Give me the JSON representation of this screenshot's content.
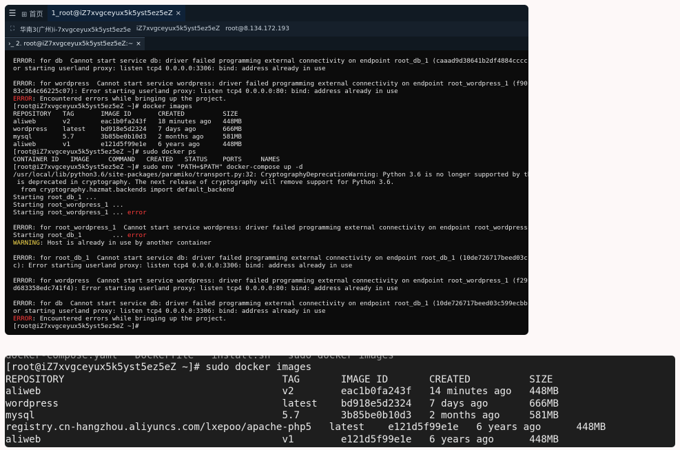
{
  "window1": {
    "tabbar": {
      "menu_icon": "menu-icon",
      "home_label": "⊞ 首页",
      "active_tab": "1_root@iZ7xvgceyux5k5yst5ez5eZ",
      "close_glyph": "×"
    },
    "crumbs": {
      "grid_icon": "grid-icon",
      "segments": [
        "华南3(广州)i-7xvgceyux5k5yst5ez5e",
        "iZ7xvgceyux5k5yst5ez5eZ",
        "root@8.134.172.193"
      ]
    },
    "subtab": {
      "label": "›_ 2. root@iZ7xvgceyux5k5yst5ez5eZ:~",
      "close_glyph": "×"
    },
    "terminal_lines": [
      [
        {
          "t": "ERROR: for db  Cannot start service db: driver failed programming external connectivity on endpoint root_db_1 (caaad9d38641b2df4884cccc"
        }
      ],
      [
        {
          "t": "or starting userland proxy: listen tcp4 0.0.0.0:3306: bind: address already in use"
        }
      ],
      [
        {
          "t": ""
        }
      ],
      [
        {
          "t": "ERROR: for wordpress  Cannot start service wordpress: driver failed programming external connectivity on endpoint root_wordpress_1 (f90"
        }
      ],
      [
        {
          "t": "83c364c66225c07): Error starting userland proxy: listen tcp4 0.0.0.0:80: bind: address already in use"
        }
      ],
      [
        {
          "t": "ERROR",
          "c": "err"
        },
        {
          "t": ": Encountered errors while bringing up the project."
        }
      ],
      [
        {
          "t": "[root@iZ7xvgceyux5k5yst5ez5eZ ~]# docker images"
        }
      ],
      [
        {
          "t": "REPOSITORY   TAG       IMAGE ID       CREATED          SIZE"
        }
      ],
      [
        {
          "t": "aliweb       v2        eac1b0fa243f   18 minutes ago   448MB"
        }
      ],
      [
        {
          "t": "wordpress    latest    bd918e5d2324   7 days ago       666MB"
        }
      ],
      [
        {
          "t": "mysql        5.7       3b85be0b10d3   2 months ago     581MB"
        }
      ],
      [
        {
          "t": "aliweb       v1        e121d5f99e1e   6 years ago      448MB"
        }
      ],
      [
        {
          "t": "[root@iZ7xvgceyux5k5yst5ez5eZ ~]# sudo docker ps"
        }
      ],
      [
        {
          "t": "CONTAINER ID   IMAGE     COMMAND   CREATED   STATUS    PORTS     NAMES"
        }
      ],
      [
        {
          "t": "[root@iZ7xvgceyux5k5yst5ez5eZ ~]# sudo env \"PATH=$PATH\" docker-compose up -d"
        }
      ],
      [
        {
          "t": "/usr/local/lib/python3.6/site-packages/paramiko/transport.py:32: CryptographyDeprecationWarning: Python 3.6 is no longer supported by th"
        }
      ],
      [
        {
          "t": " is deprecated in cryptography. The next release of cryptography will remove support for Python 3.6."
        }
      ],
      [
        {
          "t": "  from cryptography.hazmat.backends import default_backend"
        }
      ],
      [
        {
          "t": "Starting root_db_1 ..."
        }
      ],
      [
        {
          "t": "Starting root_wordpress_1 ..."
        }
      ],
      [
        {
          "t": "Starting root_wordpress_1 ... "
        },
        {
          "t": "error",
          "c": "err"
        }
      ],
      [
        {
          "t": ""
        }
      ],
      [
        {
          "t": "ERROR: for root_wordpress_1  Cannot start service wordpress: driver failed programming external connectivity on endpoint root_wordpress"
        }
      ],
      [
        {
          "t": "Starting root_db_1        ... "
        },
        {
          "t": "error",
          "c": "err"
        }
      ],
      [
        {
          "t": "WARNING",
          "c": "warn"
        },
        {
          "t": ": Host is already in use by another container"
        }
      ],
      [
        {
          "t": ""
        }
      ],
      [
        {
          "t": "ERROR: for root_db_1  Cannot start service db: driver failed programming external connectivity on endpoint root_db_1 (10de726717beed03c"
        }
      ],
      [
        {
          "t": "c): Error starting userland proxy: listen tcp4 0.0.0.0:3306: bind: address already in use"
        }
      ],
      [
        {
          "t": ""
        }
      ],
      [
        {
          "t": "ERROR: for wordpress  Cannot start service wordpress: driver failed programming external connectivity on endpoint root_wordpress_1 (f29"
        }
      ],
      [
        {
          "t": "d683358edc741f4): Error starting userland proxy: listen tcp4 0.0.0.0:80: bind: address already in use"
        }
      ],
      [
        {
          "t": ""
        }
      ],
      [
        {
          "t": "ERROR: for db  Cannot start service db: driver failed programming external connectivity on endpoint root_db_1 (10de726717beed03c599ecbb"
        }
      ],
      [
        {
          "t": "or starting userland proxy: listen tcp4 0.0.0.0:3306: bind: address already in use"
        }
      ],
      [
        {
          "t": "ERROR",
          "c": "err"
        },
        {
          "t": ": Encountered errors while bringing up the project."
        }
      ],
      [
        {
          "t": "[root@iZ7xvgceyux5k5yst5ez5eZ ~]#"
        }
      ]
    ]
  },
  "window2": {
    "terminal_lines": [
      [
        {
          "t": "docker-compose.yaml   Dockerfile   install.sh   sudo docker images",
          "c": "cut"
        }
      ],
      [
        {
          "t": "[root@iZ7xvgceyux5k5yst5ez5eZ ~]# sudo docker images"
        }
      ],
      [
        {
          "t": "REPOSITORY                                     TAG       IMAGE ID       CREATED          SIZE"
        }
      ],
      [
        {
          "t": "aliweb                                         v2        eac1b0fa243f   14 minutes ago   448MB"
        }
      ],
      [
        {
          "t": "wordpress                                      latest    bd918e5d2324   7 days ago       666MB"
        }
      ],
      [
        {
          "t": "mysql                                          5.7       3b85be0b10d3   2 months ago     581MB"
        }
      ],
      [
        {
          "t": "registry.cn-hangzhou.aliyuncs.com/lxepoo/apache-php5   latest    e121d5f99e1e   6 years ago      448MB"
        }
      ],
      [
        {
          "t": "aliweb                                         v1        e121d5f99e1e   6 years ago      448MB"
        }
      ]
    ]
  }
}
